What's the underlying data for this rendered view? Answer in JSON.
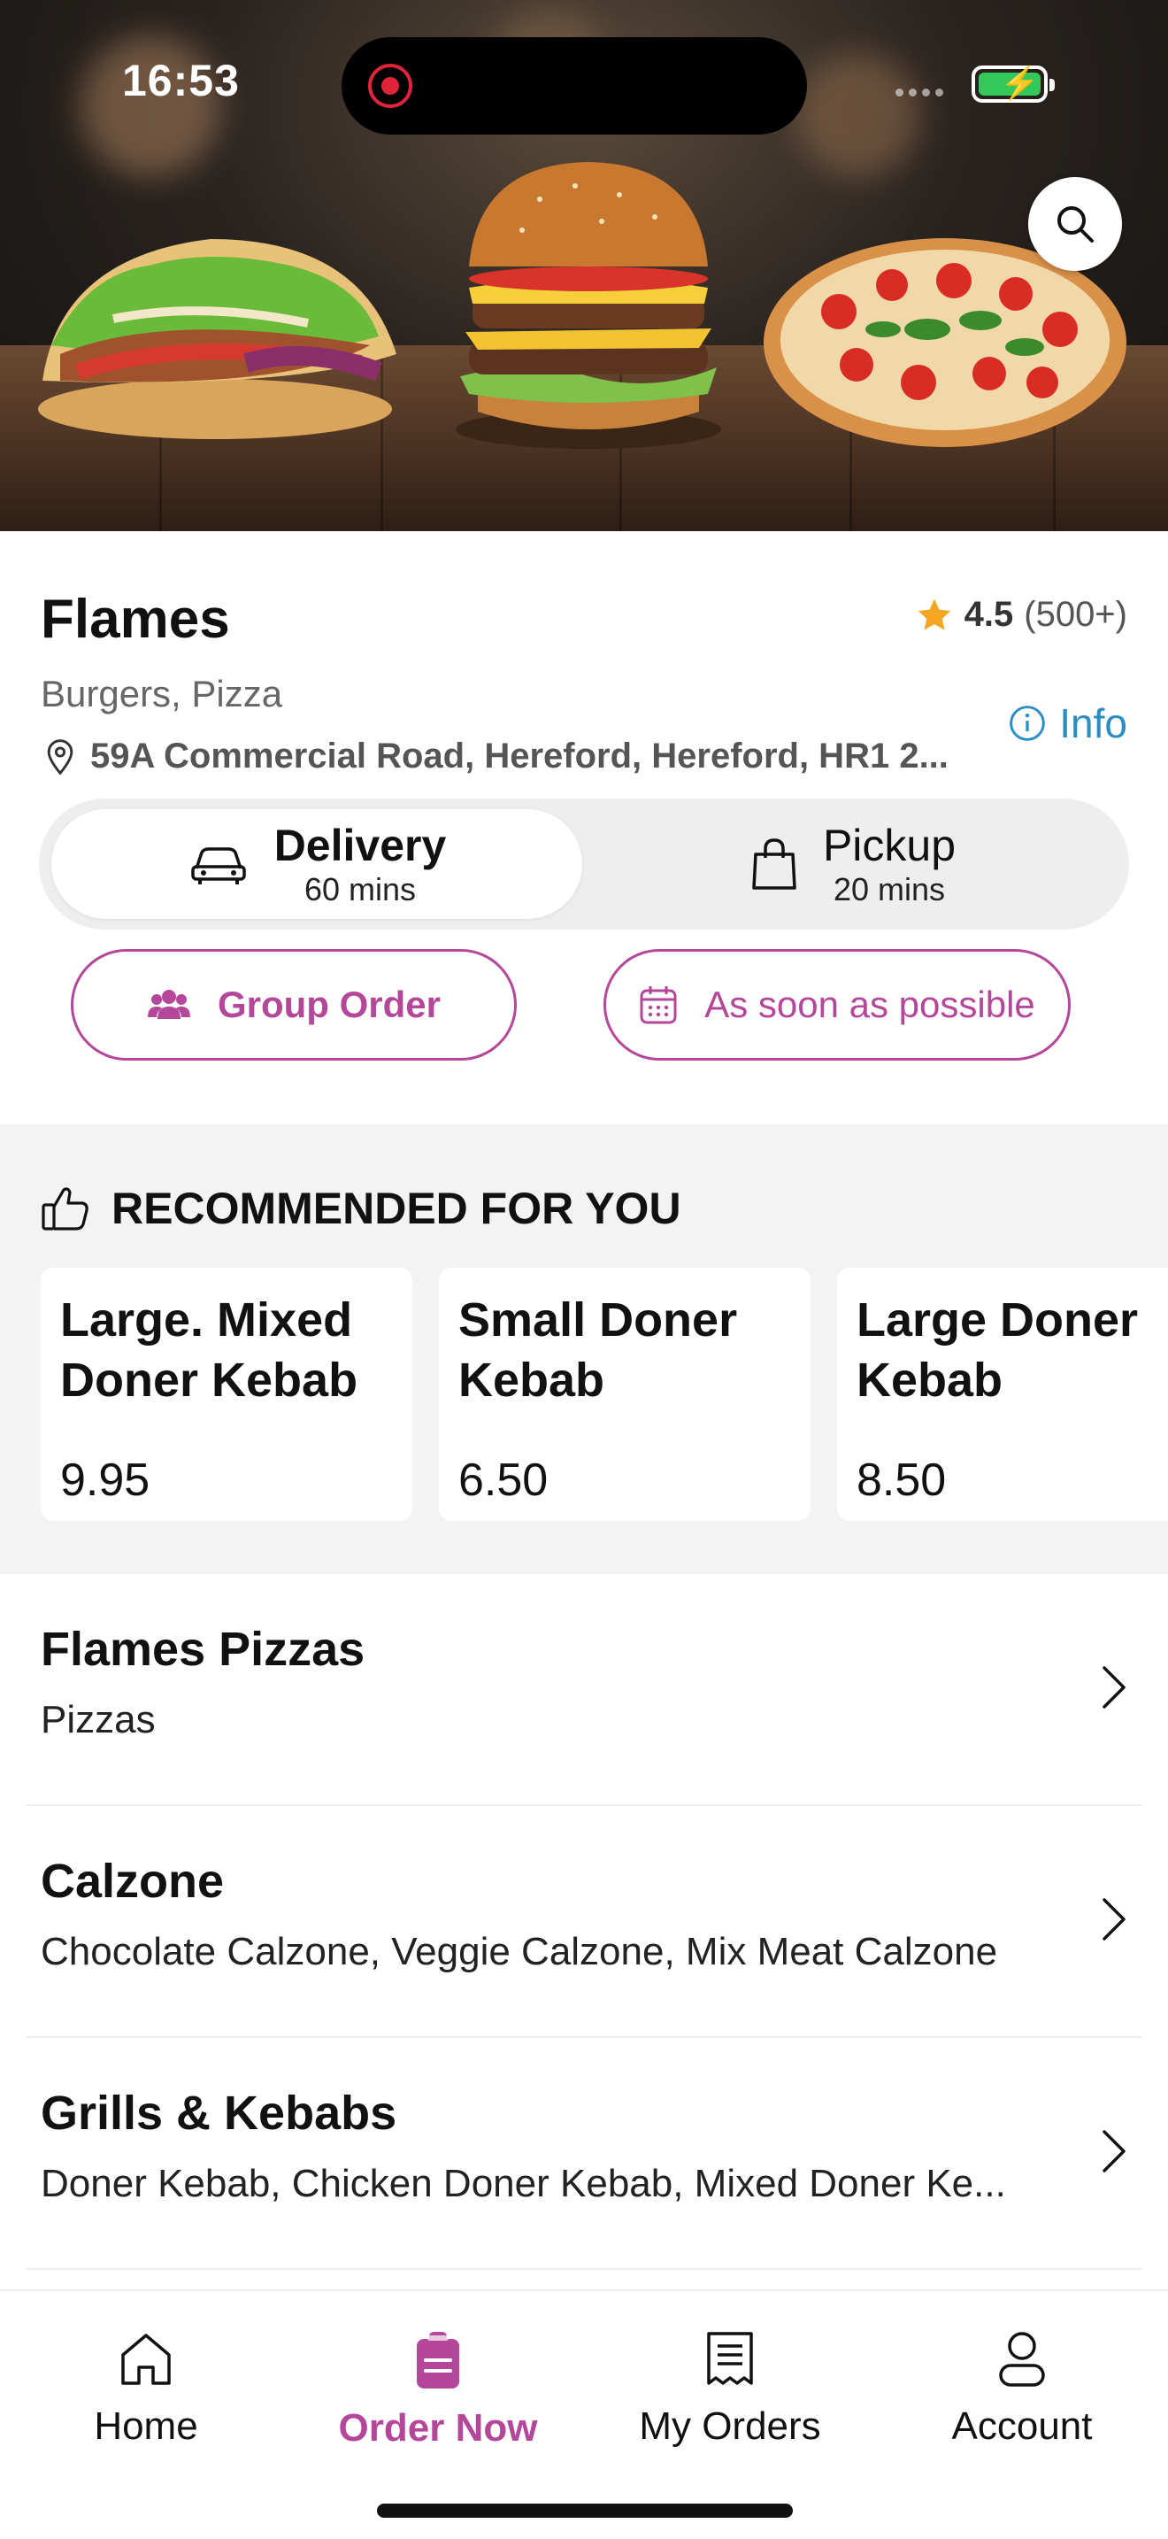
{
  "status_bar": {
    "time": "16:53"
  },
  "restaurant": {
    "name": "Flames",
    "cuisine": "Burgers, Pizza",
    "address": "59A Commercial Road, Hereford, Hereford, HR1 2...",
    "rating": "4.5",
    "rating_count": "(500+)",
    "info_label": "Info"
  },
  "order_mode": {
    "delivery": {
      "label": "Delivery",
      "time": "60 mins",
      "selected": true
    },
    "pickup": {
      "label": "Pickup",
      "time": "20 mins",
      "selected": false
    }
  },
  "actions": {
    "group_order": "Group Order",
    "schedule": "As soon as possible"
  },
  "recommended": {
    "heading": "RECOMMENDED FOR YOU",
    "items": [
      {
        "name": "Large. Mixed Doner Kebab",
        "price": "9.95"
      },
      {
        "name": "Small Doner Kebab",
        "price": "6.50"
      },
      {
        "name": "Large Doner Kebab",
        "price": "8.50"
      }
    ]
  },
  "menu_sections": [
    {
      "name": "Flames Pizzas",
      "items": "Pizzas"
    },
    {
      "name": "Calzone",
      "items": "Chocolate Calzone, Veggie Calzone, Mix Meat Calzone"
    },
    {
      "name": "Grills & Kebabs",
      "items": "Doner Kebab, Chicken Doner Kebab, Mixed Doner Ke..."
    }
  ],
  "tab_bar": {
    "items": [
      {
        "label": "Home",
        "icon": "home-icon"
      },
      {
        "label": "Order Now",
        "icon": "order-icon",
        "active": true
      },
      {
        "label": "My Orders",
        "icon": "receipt-icon"
      },
      {
        "label": "Account",
        "icon": "account-icon"
      }
    ]
  },
  "colors": {
    "accent": "#b5479b",
    "info": "#2a8ec2",
    "star": "#f5a623",
    "battery": "#34c759"
  }
}
